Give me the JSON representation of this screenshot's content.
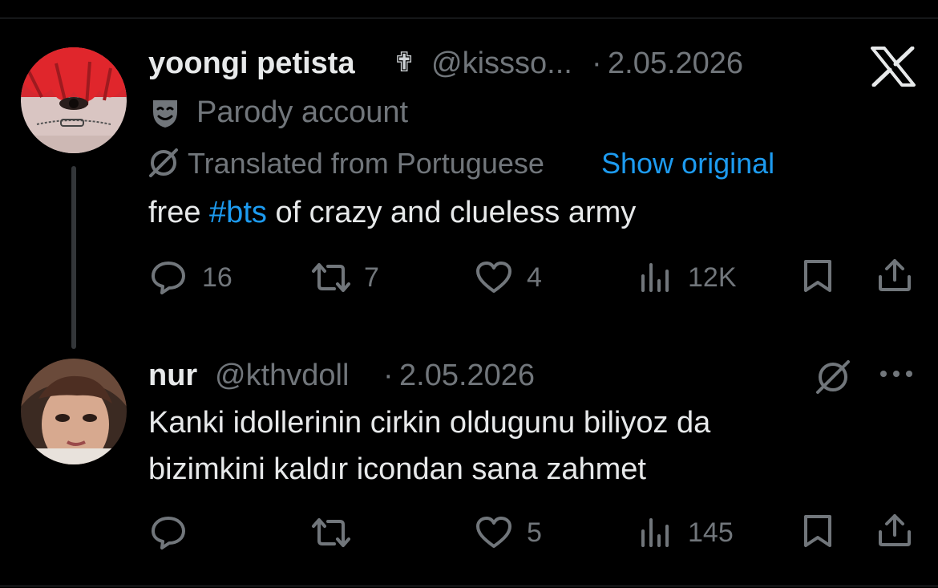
{
  "colors": {
    "background": "#000000",
    "text_primary": "#e7e9ea",
    "text_secondary": "#71767b",
    "link": "#1d9bf0",
    "divider": "#2f3336"
  },
  "tweet1": {
    "display_name": "yoongi petista",
    "name_emoji": "✟",
    "handle": "@kissso...",
    "separator": "·",
    "date": "2.05.2026",
    "label_icon": "theater-mask-icon",
    "label_text": "Parody account",
    "translated_text": "Translated from Portuguese",
    "show_original": "Show original",
    "body_before": "free",
    "hashtag": "#bts",
    "body_after": "of crazy and clueless army",
    "replies": "16",
    "reposts": "7",
    "likes": "4",
    "views": "12K"
  },
  "tweet2": {
    "display_name": "nur",
    "handle": "@kthvdoll",
    "separator": "·",
    "date": "2.05.2026",
    "body_line1": "Kanki idollerinin cirkin oldugunu biliyoz da",
    "body_line2": "bizimkini kaldır icondan sana zahmet",
    "replies": "",
    "reposts": "",
    "likes": "5",
    "views": "145"
  },
  "icons": {
    "logo": "x-logo-icon",
    "reply": "reply-icon",
    "repost": "repost-icon",
    "like": "heart-icon",
    "views": "views-icon",
    "bookmark": "bookmark-icon",
    "share": "share-icon",
    "translate": "translate-icon",
    "more": "more-icon"
  }
}
